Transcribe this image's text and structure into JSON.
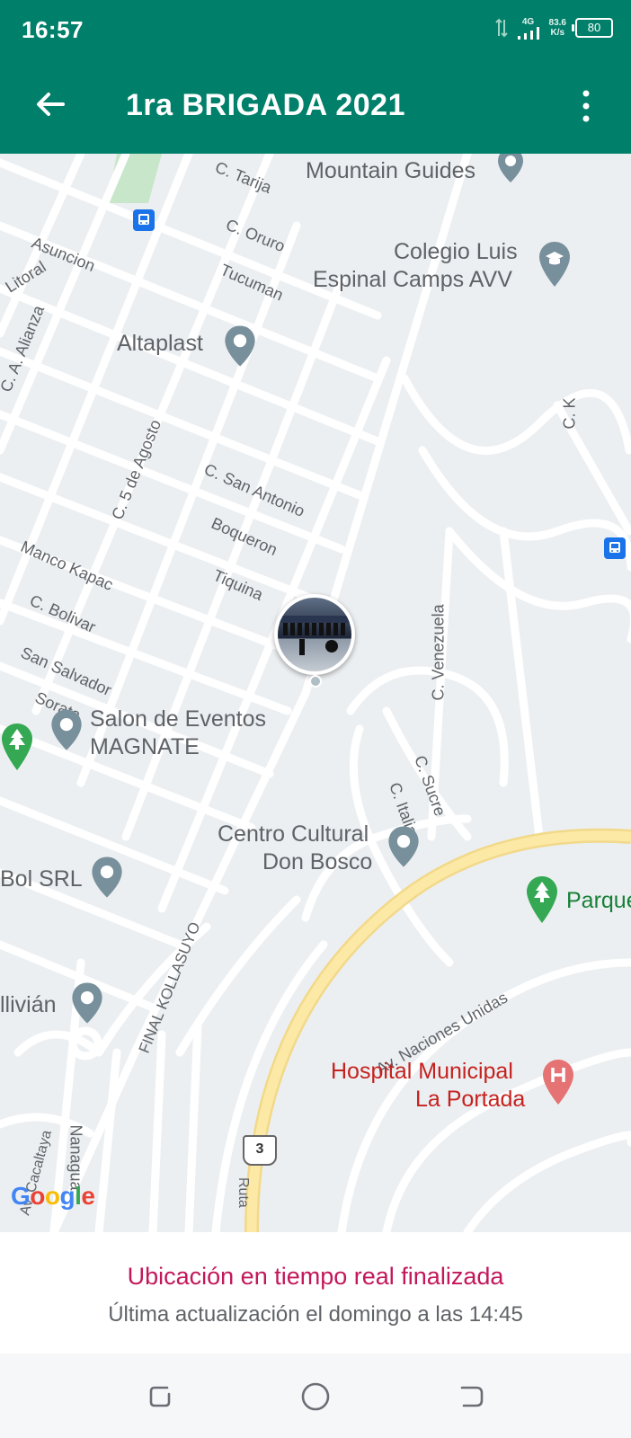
{
  "status_bar": {
    "time": "16:57",
    "network": "4G",
    "speed_value": "83.6",
    "speed_unit": "K/s",
    "battery": "80"
  },
  "app_bar": {
    "title": "1ra BRIGADA 2021",
    "back_icon": "arrow-back-icon",
    "menu_icon": "more-vert-icon"
  },
  "map": {
    "streets": {
      "tarija": "C. Tarija",
      "oruro": "C. Oruro",
      "asuncion": "Asuncion",
      "litoral": "Litoral",
      "tucuman": "Tucuman",
      "alianza": "C. A. Alianza",
      "cinco_agosto": "C. 5 de Agosto",
      "san_antonio": "C. San Antonio",
      "boqueron": "Boqueron",
      "manco_kapac": "Manco Kapac",
      "tiquina": "Tiquina",
      "bolivar": "C. Bolivar",
      "san_salvador": "San Salvador",
      "sorata": "Sorata",
      "venezuela": "C. Venezuela",
      "sucre": "C. Sucre",
      "italia": "C. Italia",
      "ck": "C. K",
      "final_kollasuyo": "FINAL KOLLASUYO",
      "naciones_unidas": "Av. Naciones Unidas",
      "nanagua": "Nanagua",
      "cacaltaya": "Av. Cacaltaya",
      "ruta": "Ruta",
      "route_shield": "3"
    },
    "places": {
      "mountain_guides": "Mountain Guides",
      "colegio_line1": "Colegio Luis",
      "colegio_line2": "Espinal Camps AVV",
      "altaplast": "Altaplast",
      "salon_line1": "Salon de Eventos",
      "salon_line2": "MAGNATE",
      "centro_line1": "Centro Cultural",
      "centro_line2": "Don Bosco",
      "bol_srl": "Bol SRL",
      "parque": "Parque",
      "bolivian": "llivián",
      "hospital_line1": "Hospital Municipal",
      "hospital_line2": "La Portada"
    },
    "google_logo": "Google",
    "colors": {
      "map_bg": "#eceff1",
      "road": "#ffffff",
      "highway": "#fce9a6",
      "park": "#c8e6c9",
      "pin_gray": "#78909c",
      "hospital_red": "#e57373",
      "park_green": "#34a853",
      "transit_blue": "#1a73e8"
    }
  },
  "footer": {
    "title": "Ubicación en tiempo real finalizada",
    "subtitle": "Última actualización el domingo a las 14:45"
  },
  "nav": {
    "recents_icon": "recents-icon",
    "home_icon": "home-circle-icon",
    "back_icon": "back-nav-icon"
  }
}
